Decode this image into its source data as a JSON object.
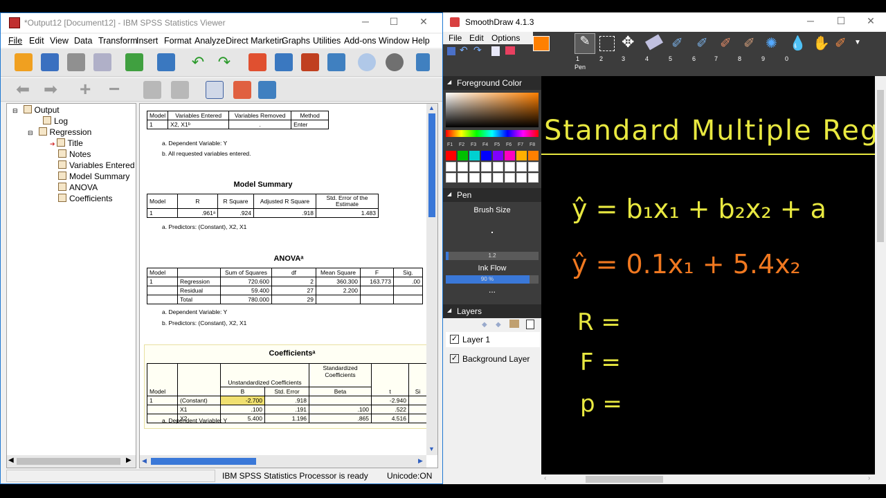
{
  "spss": {
    "title": "*Output12 [Document12] - IBM SPSS Statistics Viewer",
    "menu": [
      "File",
      "Edit",
      "View",
      "Data",
      "Transform",
      "Insert",
      "Format",
      "Analyze",
      "Direct Marketin",
      "Graphs",
      "Utilities",
      "Add-ons",
      "Window",
      "Help"
    ],
    "tree": {
      "output": "Output",
      "log": "Log",
      "regression": "Regression",
      "items": [
        "Title",
        "Notes",
        "Variables Entered",
        "Model Summary",
        "ANOVA",
        "Coefficients"
      ]
    },
    "vars_table": {
      "headers": [
        "Model",
        "Variables Entered",
        "Variables Removed",
        "Method"
      ],
      "row": [
        "1",
        "X2, X1ᵇ",
        ".",
        "Enter"
      ],
      "notes": [
        "a. Dependent Variable: Y",
        "b. All requested variables entered."
      ]
    },
    "model_summary": {
      "title": "Model Summary",
      "headers": [
        "Model",
        "R",
        "R Square",
        "Adjusted R Square",
        "Std. Error of the Estimate"
      ],
      "row": [
        "1",
        ".961ᵃ",
        ".924",
        ".918",
        "1.483"
      ],
      "note": "a. Predictors: (Constant), X2, X1"
    },
    "anova": {
      "title": "ANOVAᵃ",
      "headers": [
        "Model",
        "",
        "Sum of Squares",
        "df",
        "Mean Square",
        "F",
        "Sig."
      ],
      "rows": [
        [
          "1",
          "Regression",
          "720.600",
          "2",
          "360.300",
          "163.773",
          ".00"
        ],
        [
          "",
          "Residual",
          "59.400",
          "27",
          "2.200",
          "",
          ""
        ],
        [
          "",
          "Total",
          "780.000",
          "29",
          "",
          "",
          ""
        ]
      ],
      "notes": [
        "a. Dependent Variable: Y",
        "b. Predictors: (Constant), X2, X1"
      ]
    },
    "coefficients": {
      "title": "Coefficientsᵃ",
      "group_unstd": "Unstandardized Coefficients",
      "group_std": "Standardized Coefficients",
      "sub": [
        "Model",
        "B",
        "Std. Error",
        "Beta",
        "t",
        "Si"
      ],
      "rows": [
        [
          "1",
          "(Constant)",
          "-2.700",
          ".918",
          "",
          "-2.940"
        ],
        [
          "",
          "X1",
          ".100",
          ".191",
          ".100",
          ".522"
        ],
        [
          "",
          "X2",
          "5.400",
          "1.196",
          ".865",
          "4.516"
        ]
      ],
      "note": "a. Dependent Variable: Y"
    },
    "status": "IBM SPSS Statistics Processor is ready",
    "unicode": "Unicode:ON"
  },
  "smoothdraw": {
    "title": "SmoothDraw 4.1.3",
    "menu": [
      "File",
      "Edit",
      "Options"
    ],
    "pen_label": "Pen",
    "foreground_color": "Foreground Color",
    "fkeys": [
      "F1",
      "F2",
      "F3",
      "F4",
      "F5",
      "F6",
      "F7",
      "F8"
    ],
    "palette": [
      "#ff0000",
      "#00c000",
      "#00d0d0",
      "#0000ff",
      "#8000ff",
      "#ff00c0",
      "#ffb000",
      "#ff8000"
    ],
    "pen_section": "Pen",
    "brush_size": "Brush Size",
    "brush_value": "1.2",
    "ink_flow": "Ink Flow",
    "ink_value": "90 %",
    "ink_fraction": 0.9,
    "ellipsis": "...",
    "layers_section": "Layers",
    "layers": [
      "Layer 1",
      "Background Layer"
    ],
    "tool_numbers": [
      "1",
      "2",
      "3",
      "4",
      "5",
      "6",
      "7",
      "8",
      "9",
      "0"
    ],
    "canvas": {
      "heading": "Standard Multiple Regres",
      "eq1": "ŷ = b₁x₁ + b₂x₂ + a",
      "eq2": "ŷ = 0.1x₁ + 5.4x₂",
      "r": "R =",
      "f": "F =",
      "p": "p ="
    }
  },
  "colors": {
    "handwriting_yellow": "#e8e840",
    "handwriting_orange": "#f07820",
    "fg_color": "#ff8000"
  }
}
